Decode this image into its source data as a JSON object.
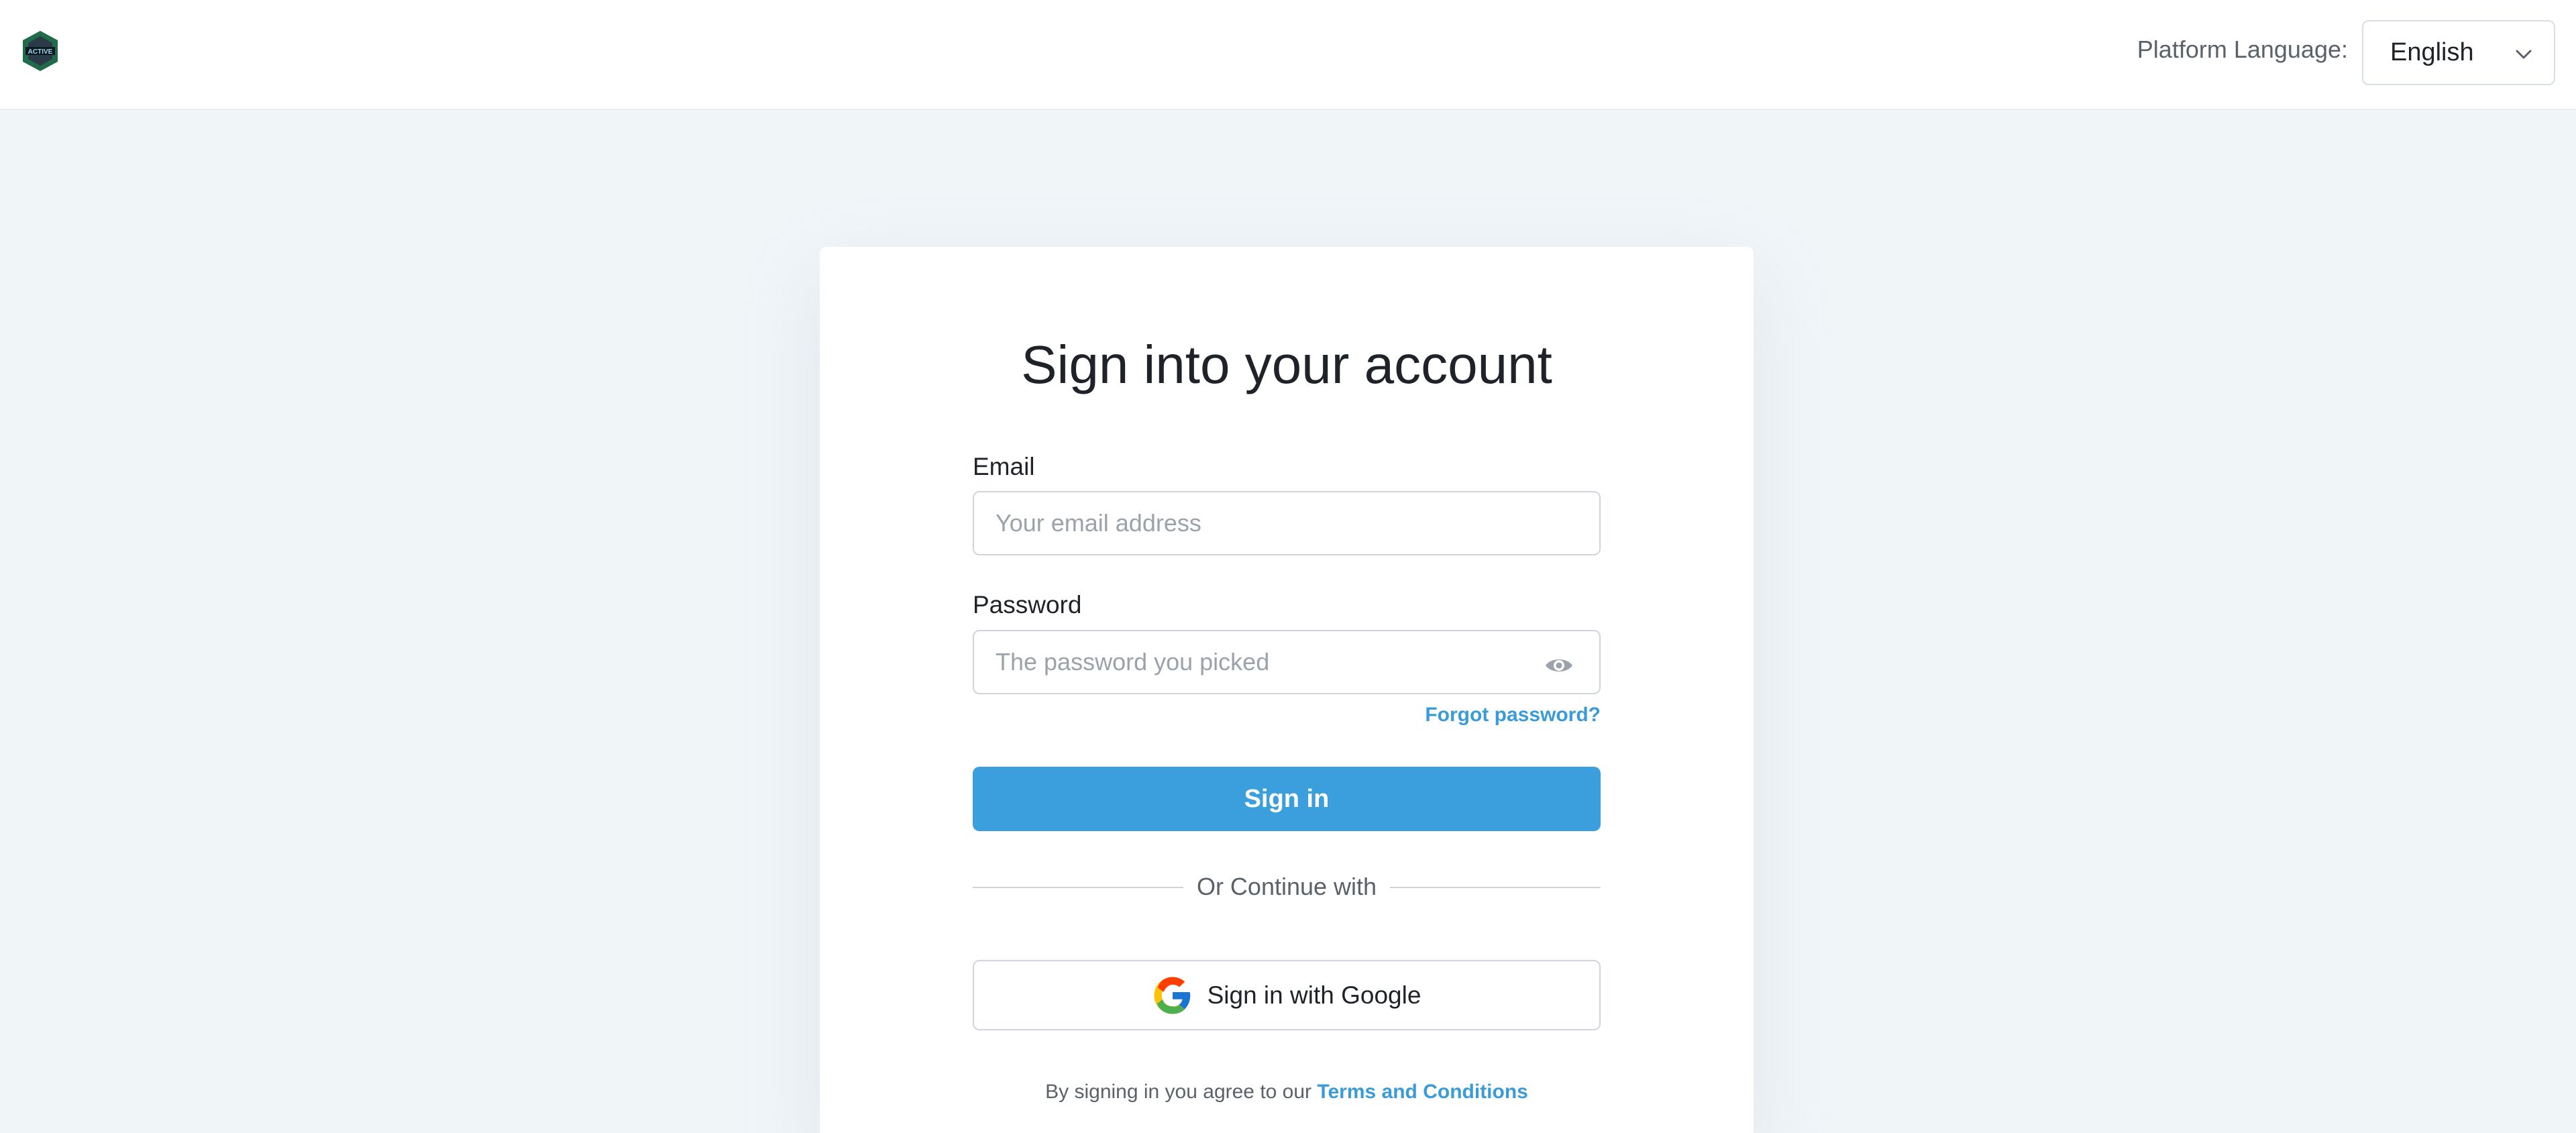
{
  "header": {
    "logo_icon": "brand-logo-icon",
    "language_label": "Platform Language:",
    "language_selected": "English",
    "language_chevron_icon": "chevron-down-icon"
  },
  "login": {
    "title": "Sign into your account",
    "email_label": "Email",
    "email_placeholder": "Your email address",
    "email_value": "",
    "password_label": "Password",
    "password_placeholder": "The password you picked",
    "password_value": "",
    "password_toggle_icon": "eye-icon",
    "forgot_password": "Forgot password?",
    "sign_in_button": "Sign in",
    "divider_text": "Or Continue with",
    "google_button": "Sign in with Google",
    "google_icon": "google-icon",
    "terms_prefix": "By signing in you agree to our",
    "terms_link": "Terms and Conditions"
  },
  "colors": {
    "page_background": "#f0f5f8",
    "accent": "#3a9fdc",
    "link": "#3a9bd9",
    "text": "#1f2329",
    "muted_text": "#5a6168"
  }
}
